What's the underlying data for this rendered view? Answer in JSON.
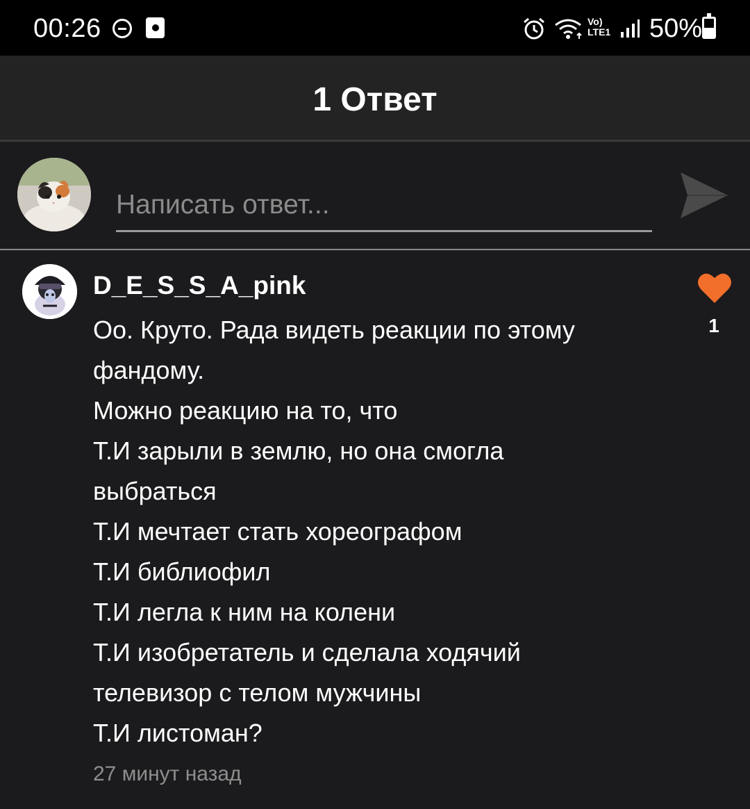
{
  "status_bar": {
    "time": "00:26",
    "network_label": "Vo) LTE1",
    "battery_percent": "50%",
    "battery_level": 0.5
  },
  "header": {
    "title": "1 Ответ"
  },
  "reply": {
    "placeholder": "Написать ответ...",
    "send_icon": "send-arrow-icon"
  },
  "comment": {
    "username": "D_E_S_S_A_pink",
    "lines": [
      "Оо. Круто. Рада видеть реакции по этому",
      "фандому.",
      "Можно реакцию на то, что",
      "Т.И зарыли в землю, но она смогла",
      "выбраться",
      "Т.И мечтает стать хореографом",
      "Т.И библиофил",
      "Т.И легла к ним на колени",
      "Т.И изобретатель и сделала ходячий",
      "телевизор с телом мужчины",
      "Т.И листоман?"
    ],
    "timestamp": "27 минут назад",
    "like_count": "1",
    "like_color": "#f26f2b"
  },
  "colors": {
    "background": "#1b1a1c",
    "header_bg": "#242324",
    "status_bg": "#000000",
    "accent_like": "#f26f2b",
    "muted_text": "#8e8e8e"
  }
}
